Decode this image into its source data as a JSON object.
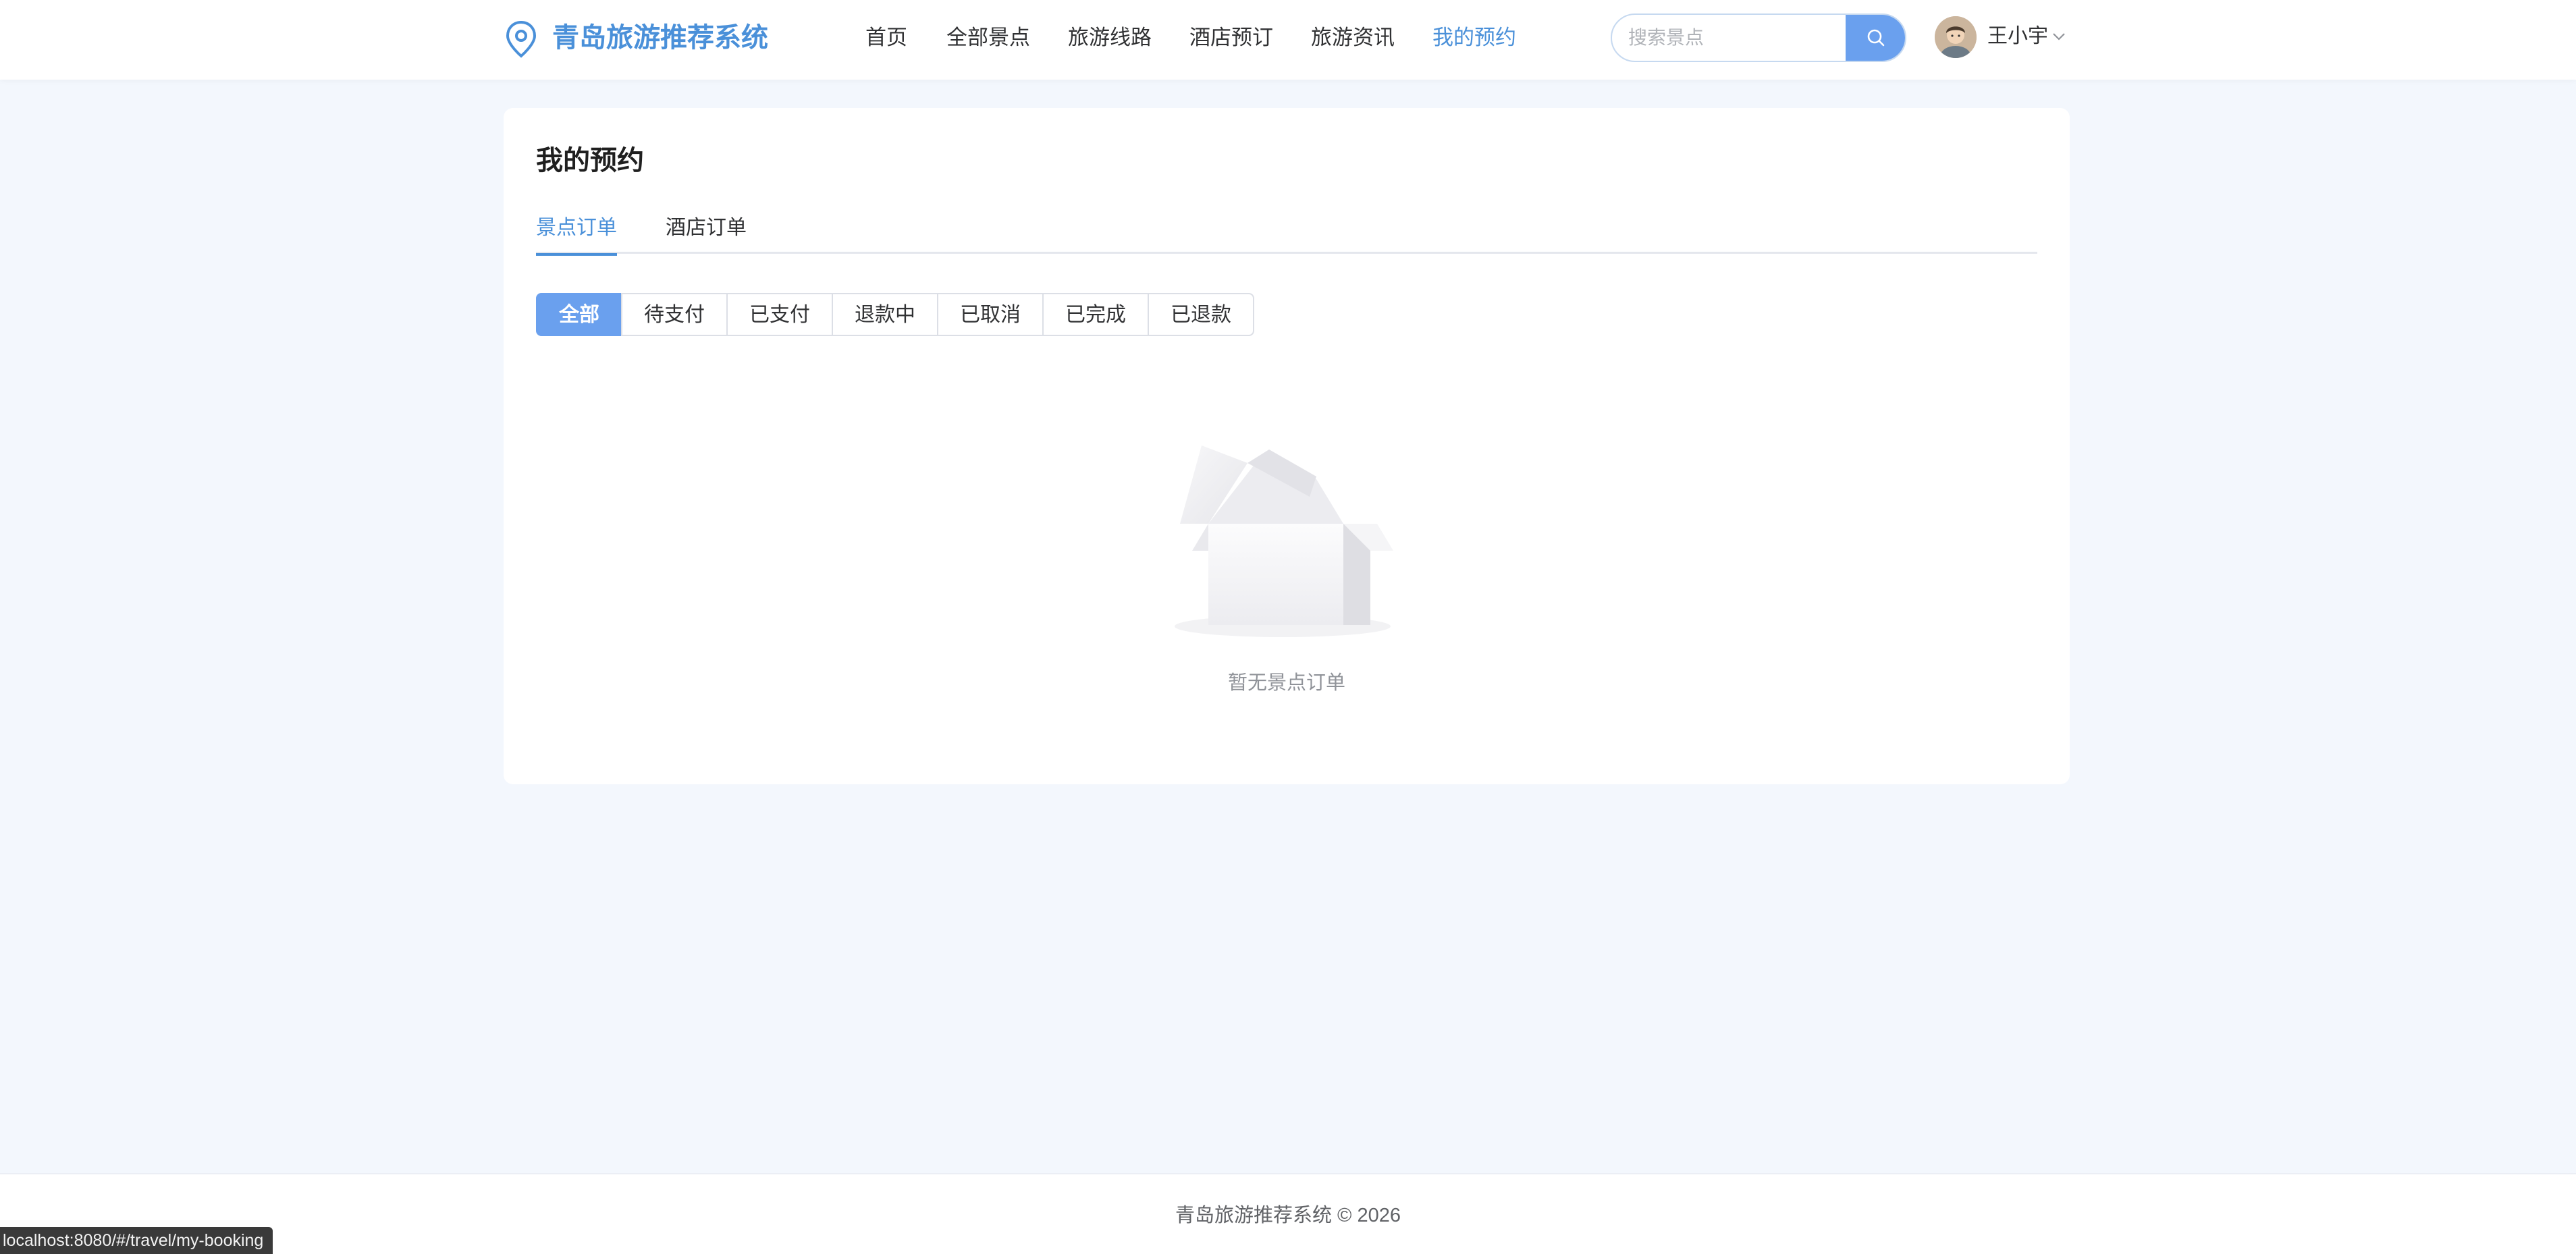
{
  "header": {
    "logo_icon": "location-pin-icon",
    "brand": "青岛旅游推荐系统",
    "nav": [
      {
        "label": "首页",
        "active": false
      },
      {
        "label": "全部景点",
        "active": false
      },
      {
        "label": "旅游线路",
        "active": false
      },
      {
        "label": "酒店预订",
        "active": false
      },
      {
        "label": "旅游资讯",
        "active": false
      },
      {
        "label": "我的预约",
        "active": true
      }
    ],
    "search": {
      "placeholder": "搜索景点",
      "value": "",
      "icon": "search-icon"
    },
    "user": {
      "name": "王小宇",
      "caret_icon": "chevron-down-icon"
    }
  },
  "main": {
    "title": "我的预约",
    "tabs": [
      {
        "label": "景点订单",
        "active": true
      },
      {
        "label": "酒店订单",
        "active": false
      }
    ],
    "filters": [
      {
        "label": "全部",
        "active": true
      },
      {
        "label": "待支付",
        "active": false
      },
      {
        "label": "已支付",
        "active": false
      },
      {
        "label": "退款中",
        "active": false
      },
      {
        "label": "已取消",
        "active": false
      },
      {
        "label": "已完成",
        "active": false
      },
      {
        "label": "已退款",
        "active": false
      }
    ],
    "empty_text": "暂无景点订单"
  },
  "footer": {
    "text": "青岛旅游推荐系统 © 2026"
  },
  "status_bar": {
    "url": "localhost:8080/#/travel/my-booking"
  },
  "colors": {
    "accent": "#4a90d9",
    "button": "#6aa0ee",
    "background": "#f3f7fd"
  }
}
